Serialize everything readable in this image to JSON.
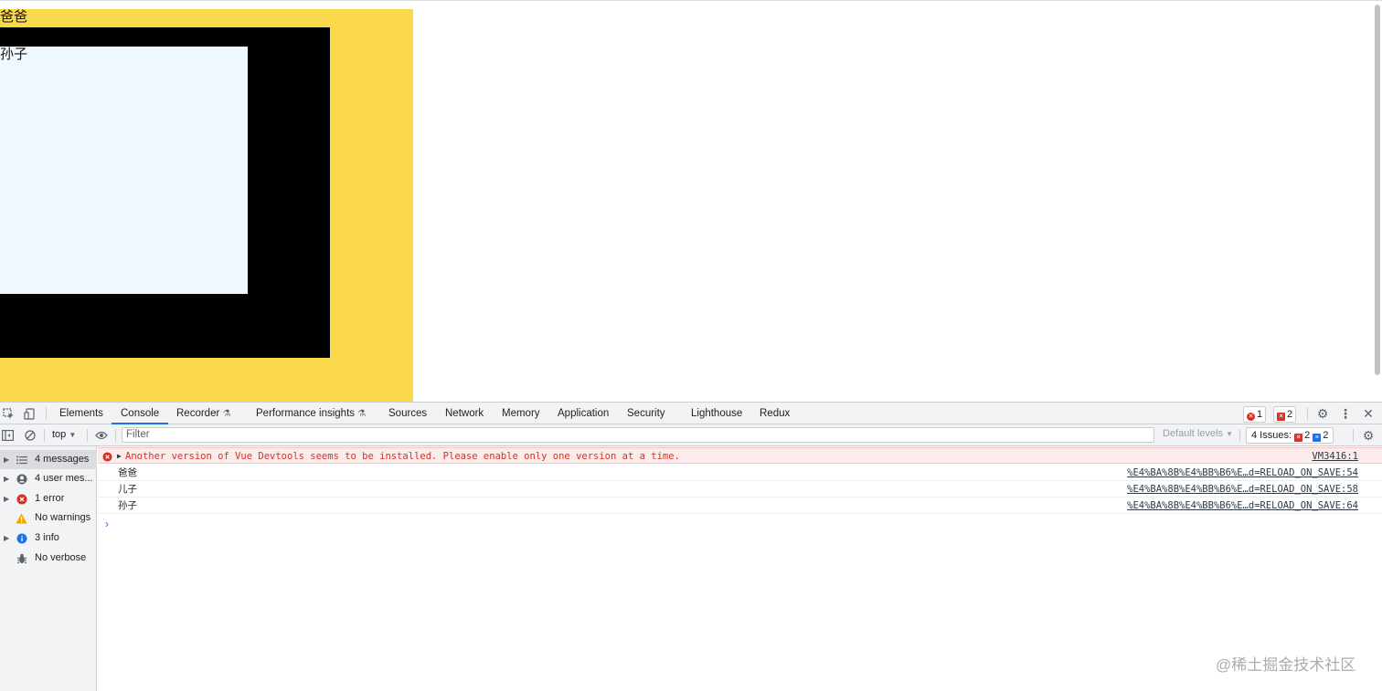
{
  "page": {
    "dad_label": "爸爸",
    "grandson_label": "孙子"
  },
  "devtools": {
    "tabs": [
      "Elements",
      "Console",
      "Recorder",
      "Performance insights",
      "Sources",
      "Network",
      "Memory",
      "Application",
      "Security",
      "Lighthouse",
      "Redux"
    ],
    "active_tab": "Console",
    "error_count": "1",
    "issue_count": "2",
    "toolbar": {
      "context": "top",
      "filter_placeholder": "Filter",
      "levels": "Default levels",
      "issues_label": "4 Issues:",
      "issues_errors": "2",
      "issues_info": "2"
    },
    "sidebar": [
      {
        "label": "4 messages",
        "icon": "list-icon"
      },
      {
        "label": "4 user mes...",
        "icon": "user-icon"
      },
      {
        "label": "1 error",
        "icon": "error-icon"
      },
      {
        "label": "No warnings",
        "icon": "warning-icon"
      },
      {
        "label": "3 info",
        "icon": "info-icon"
      },
      {
        "label": "No verbose",
        "icon": "bug-icon"
      }
    ],
    "messages": [
      {
        "text": "Another version of Vue Devtools seems to be installed. Please enable only one version at a time.",
        "source": "VM3416:1",
        "level": "error"
      },
      {
        "text": "爸爸",
        "source": "%E4%BA%8B%E4%BB%B6%E…d=RELOAD_ON_SAVE:54",
        "level": "info"
      },
      {
        "text": "儿子",
        "source": "%E4%BA%8B%E4%BB%B6%E…d=RELOAD_ON_SAVE:58",
        "level": "info"
      },
      {
        "text": "孙子",
        "source": "%E4%BA%8B%E4%BB%B6%E…d=RELOAD_ON_SAVE:64",
        "level": "info"
      }
    ]
  },
  "watermark": "@稀土掘金技术社区",
  "colors": {
    "dad_bg": "#f9d949",
    "son_bg": "#000000",
    "grandson_bg": "#eff8ff",
    "accent": "#1a73e8",
    "error": "#d93025"
  }
}
